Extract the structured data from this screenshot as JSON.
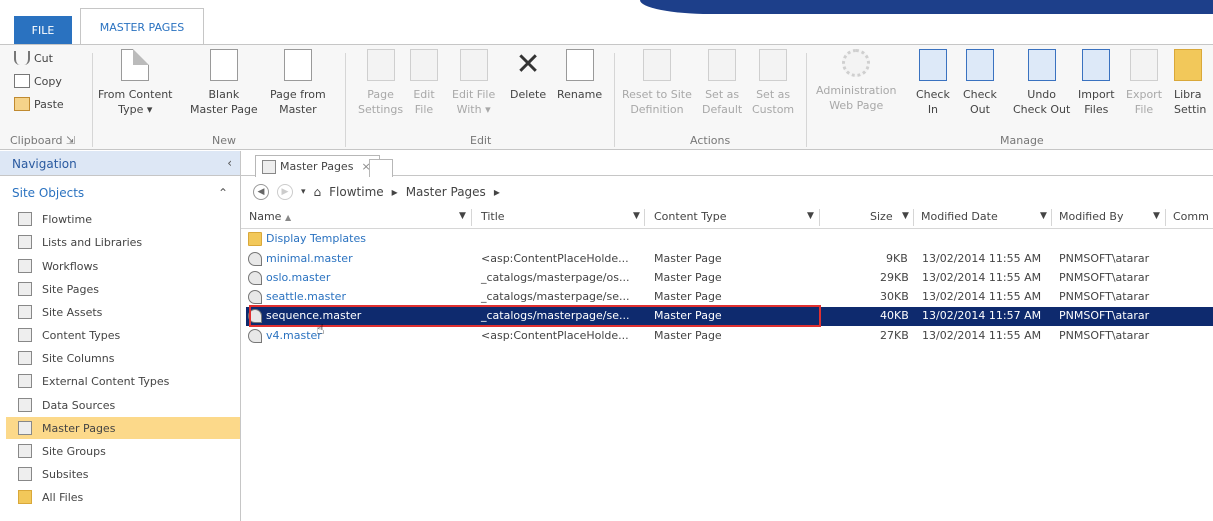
{
  "tabs": {
    "file": "FILE",
    "master_pages": "MASTER PAGES"
  },
  "clipboard": {
    "cut": "Cut",
    "copy": "Copy",
    "paste": "Paste",
    "group": "Clipboard"
  },
  "new_group": {
    "from_content": [
      "From Content",
      "Type ▾"
    ],
    "blank": [
      "Blank",
      "Master Page"
    ],
    "page_from": [
      "Page from",
      "Master"
    ],
    "group": "New"
  },
  "edit_group": {
    "page_settings": [
      "Page",
      "Settings"
    ],
    "edit_file": [
      "Edit",
      "File"
    ],
    "edit_file_with": [
      "Edit File",
      "With ▾"
    ],
    "delete": "Delete",
    "rename": "Rename",
    "group": "Edit"
  },
  "actions_group": {
    "reset": [
      "Reset to Site",
      "Definition"
    ],
    "set_default": [
      "Set as",
      "Default"
    ],
    "set_custom": [
      "Set as",
      "Custom"
    ],
    "group": "Actions"
  },
  "manage_group": {
    "admin": [
      "Administration",
      "Web Page"
    ],
    "check_in": [
      "Check",
      "In"
    ],
    "check_out": [
      "Check",
      "Out"
    ],
    "undo": [
      "Undo",
      "Check Out"
    ],
    "import": [
      "Import",
      "Files"
    ],
    "export": [
      "Export",
      "File"
    ],
    "library": [
      "Libra",
      "Settin"
    ],
    "group": "Manage"
  },
  "nav": {
    "header": "Navigation",
    "section": "Site Objects",
    "items": [
      "Flowtime",
      "Lists and Libraries",
      "Workflows",
      "Site Pages",
      "Site Assets",
      "Content Types",
      "Site Columns",
      "External Content Types",
      "Data Sources",
      "Master Pages",
      "Site Groups",
      "Subsites",
      "All Files"
    ],
    "selected": "Master Pages"
  },
  "doc_tab": "Master Pages",
  "breadcrumb": {
    "root": "Flowtime",
    "sep": "▸",
    "current": "Master Pages"
  },
  "columns": {
    "name": "Name",
    "title": "Title",
    "content_type": "Content Type",
    "size": "Size",
    "modified_date": "Modified Date",
    "modified_by": "Modified By",
    "comments": "Comm"
  },
  "rows": [
    {
      "name": "Display Templates",
      "title": "",
      "type": "",
      "size": "",
      "date": "",
      "by": "",
      "folder": true
    },
    {
      "name": "minimal.master",
      "title": "<asp:ContentPlaceHolde...",
      "type": "Master Page",
      "size": "9KB",
      "date": "13/02/2014 11:55 AM",
      "by": "PNMSOFT\\atarar"
    },
    {
      "name": "oslo.master",
      "title": "_catalogs/masterpage/os...",
      "type": "Master Page",
      "size": "29KB",
      "date": "13/02/2014 11:55 AM",
      "by": "PNMSOFT\\atarar"
    },
    {
      "name": "seattle.master",
      "title": "_catalogs/masterpage/se...",
      "type": "Master Page",
      "size": "30KB",
      "date": "13/02/2014 11:55 AM",
      "by": "PNMSOFT\\atarar"
    },
    {
      "name": "sequence.master",
      "title": "_catalogs/masterpage/se...",
      "type": "Master Page",
      "size": "40KB",
      "date": "13/02/2014 11:57 AM",
      "by": "PNMSOFT\\atarar",
      "selected": true
    },
    {
      "name": "v4.master",
      "title": "<asp:ContentPlaceHolde...",
      "type": "Master Page",
      "size": "27KB",
      "date": "13/02/2014 11:55 AM",
      "by": "PNMSOFT\\atarar"
    }
  ],
  "colors": {
    "accent": "#2a72c0",
    "selected_row": "#0e2a6e",
    "highlight_box": "#e03030",
    "nav_selected": "#fcd98a"
  }
}
